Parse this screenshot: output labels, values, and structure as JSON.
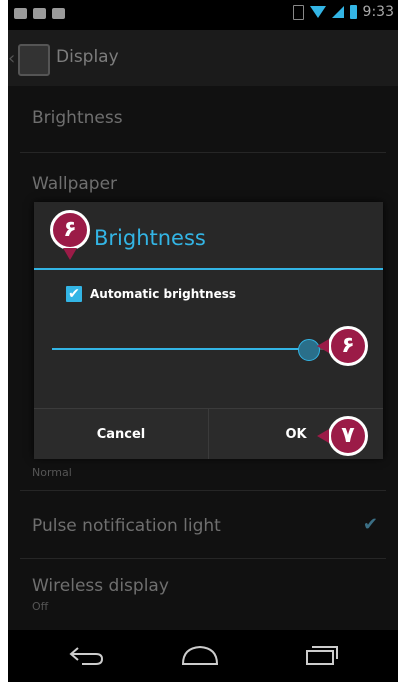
{
  "status_bar": {
    "time": "9:33",
    "left_icons": [
      "mail-icon",
      "chat-icon",
      "gamepad-icon"
    ],
    "right_icons": [
      "sim-icon",
      "wifi-icon",
      "signal-icon",
      "battery-icon"
    ]
  },
  "action_bar": {
    "title": "Display",
    "icon": "display-settings-icon"
  },
  "settings": [
    {
      "label": "Brightness",
      "sub": ""
    },
    {
      "label": "Wallpaper",
      "sub": ""
    },
    {
      "label": "",
      "sub": "Normal"
    },
    {
      "label": "Pulse notification light",
      "sub": "",
      "checked": true
    },
    {
      "label": "Wireless display",
      "sub": "Off"
    }
  ],
  "dialog": {
    "title": "Brightness",
    "checkbox_label": "Automatic brightness",
    "checkbox_checked": true,
    "slider_level": 0.82,
    "cancel_label": "Cancel",
    "ok_label": "OK"
  },
  "annotations": {
    "badge_title": "۶",
    "badge_slider": "۶",
    "badge_ok": "۷"
  },
  "nav_bar": {
    "icons": [
      "back-icon",
      "home-icon",
      "recent-apps-icon"
    ]
  },
  "colors": {
    "accent": "#33b5e5",
    "badge": "#9b1b47"
  }
}
